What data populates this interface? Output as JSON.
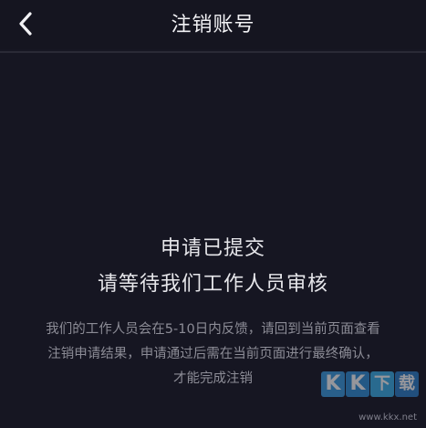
{
  "header": {
    "title": "注销账号",
    "back_icon": "chevron-left-icon"
  },
  "status": {
    "line1": "申请已提交",
    "line2": "请等待我们工作人员审核"
  },
  "description": {
    "line1": "我们的工作人员会在5-10日内反馈，请回到当前页面查看",
    "line2": "注销申请结果，申请通过后需在当前页面进行最终确认，",
    "line3": "才能完成注销"
  },
  "watermark": {
    "logo_text": "KK下载",
    "url": "www.kkx.net",
    "colors": [
      "#3a9be0",
      "#2f8fd6",
      "#3ab0e8",
      "#2a7fc8"
    ]
  },
  "colors": {
    "background": "#161622",
    "title_text": "#f2f2f5",
    "body_text": "#e6e6ea",
    "secondary_text": "#8c8c96"
  }
}
